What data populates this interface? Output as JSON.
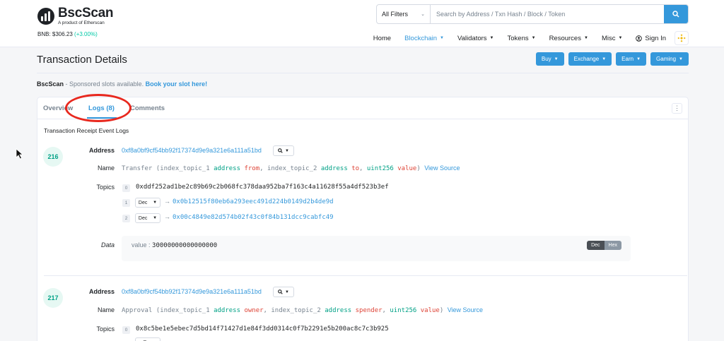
{
  "header": {
    "logo_title": "BscScan",
    "logo_sub": "A product of Etherscan",
    "bnb_label": "BNB: $306.23",
    "bnb_change": "(+3.00%)",
    "filter_label": "All Filters",
    "search_placeholder": "Search by Address / Txn Hash / Block / Token",
    "nav": [
      {
        "label": "Home"
      },
      {
        "label": "Blockchain"
      },
      {
        "label": "Validators"
      },
      {
        "label": "Tokens"
      },
      {
        "label": "Resources"
      },
      {
        "label": "Misc"
      },
      {
        "label": "Sign In"
      }
    ]
  },
  "page": {
    "title": "Transaction Details",
    "buttons": [
      "Buy",
      "Exchange",
      "Earn",
      "Gaming"
    ],
    "sponsor_brand": "BscScan",
    "sponsor_text": " - Sponsored slots available. ",
    "sponsor_link": "Book your slot here!"
  },
  "tabs": {
    "overview": "Overview",
    "logs": "Logs (8)",
    "comments": "Comments"
  },
  "section_label": "Transaction Receipt Event Logs",
  "labels": {
    "address": "Address",
    "name": "Name",
    "topics": "Topics",
    "data": "Data",
    "dec": "Dec",
    "hex": "Hex"
  },
  "logs": [
    {
      "index": "216",
      "address": "0xf8a0bf9cf54bb92f17374d9e9a321e6a111a51bd",
      "event": {
        "name": "Transfer",
        "p1_prefix": "index_topic_1",
        "p1_type": "address",
        "p1_name": "from",
        "p2_prefix": "index_topic_2",
        "p2_type": "address",
        "p2_name": "to",
        "p3_type": "uint256",
        "p3_name": "value",
        "view_source": "View Source"
      },
      "topics": [
        {
          "idx": "0",
          "value": "0xddf252ad1be2c89b69c2b068fc378daa952ba7f163c4a11628f55a4df523b3ef"
        },
        {
          "idx": "1",
          "value": "0x0b12515f80eb6a293eec491d224b0149d2b4de9d"
        },
        {
          "idx": "2",
          "value": "0x00c4849e82d574b02f43c0f84b131dcc9cabfc49"
        }
      ],
      "data_key": "value :",
      "data_value": "30000000000000000"
    },
    {
      "index": "217",
      "address": "0xf8a0bf9cf54bb92f17374d9e9a321e6a111a51bd",
      "event": {
        "name": "Approval",
        "p1_prefix": "index_topic_1",
        "p1_type": "address",
        "p1_name": "owner",
        "p2_prefix": "index_topic_2",
        "p2_type": "address",
        "p2_name": "spender",
        "p3_type": "uint256",
        "p3_name": "value",
        "view_source": "View Source"
      },
      "topics": [
        {
          "idx": "0",
          "value": "0x8c5be1e5ebec7d5bd14f71427d1e84f3dd0314c0f7b2291e5b200ac8c7c3b925"
        }
      ]
    }
  ],
  "icons": {
    "search": "search-icon",
    "bnb": "bnb-logo-icon",
    "user": "user-icon",
    "cursor": "mouse-cursor-icon"
  },
  "colors": {
    "accent": "#3498db",
    "success": "#00c9a7",
    "annotation": "#e8281e"
  }
}
